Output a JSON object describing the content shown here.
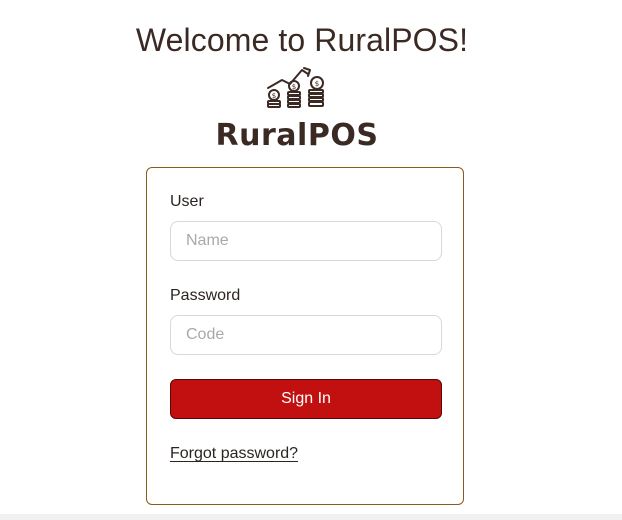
{
  "header": {
    "welcome_text": "Welcome to RuralPOS!",
    "logo_icon": "coins-growth-icon",
    "brand_name": "RuralPOS"
  },
  "login_form": {
    "user_label": "User",
    "user_placeholder": "Name",
    "user_value": "",
    "password_label": "Password",
    "password_placeholder": "Code",
    "password_value": "",
    "sign_in_label": "Sign In",
    "forgot_password_label": "Forgot password?"
  },
  "colors": {
    "text": "#3b2a24",
    "card_border": "#8a5a1c",
    "button_bg": "#c20f0f",
    "button_text": "#ffffff"
  }
}
